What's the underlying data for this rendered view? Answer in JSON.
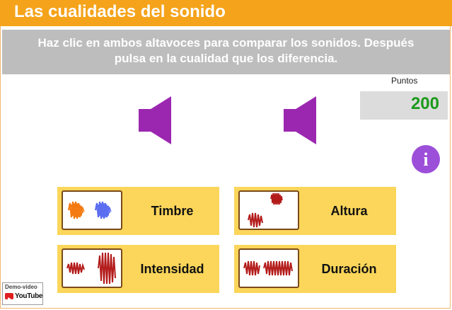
{
  "app": {
    "title": "Las cualidades del sonido"
  },
  "instructions": {
    "line1": "Haz clic en ambos altavoces para comparar los sonidos. Después",
    "line2": "pulsa en la cualidad que los diferencia."
  },
  "score": {
    "label": "Puntos",
    "value": "200"
  },
  "speakers": [
    {
      "name": "speaker-left",
      "icon": "speaker-icon"
    },
    {
      "name": "speaker-right",
      "icon": "speaker-icon"
    }
  ],
  "info_button": {
    "icon": "info-icon",
    "glyph": "i"
  },
  "options": [
    {
      "label": "Timbre",
      "icon": "timbre-waves-icon"
    },
    {
      "label": "Altura",
      "icon": "pitch-waves-icon"
    },
    {
      "label": "Intensidad",
      "icon": "intensity-waves-icon"
    },
    {
      "label": "Duración",
      "icon": "duration-waves-icon"
    }
  ],
  "badge": {
    "demo": "Demo-video",
    "brand": "YouTube"
  },
  "colors": {
    "title_bar": "#f5a31a",
    "instructions_bg": "#bdbdbd",
    "speaker": "#9b27b0",
    "card": "#fbd65a",
    "points": "#1b9a1b",
    "wave_red": "#b31a1a",
    "wave_orange": "#f47a10",
    "wave_blue": "#5b6df0"
  }
}
